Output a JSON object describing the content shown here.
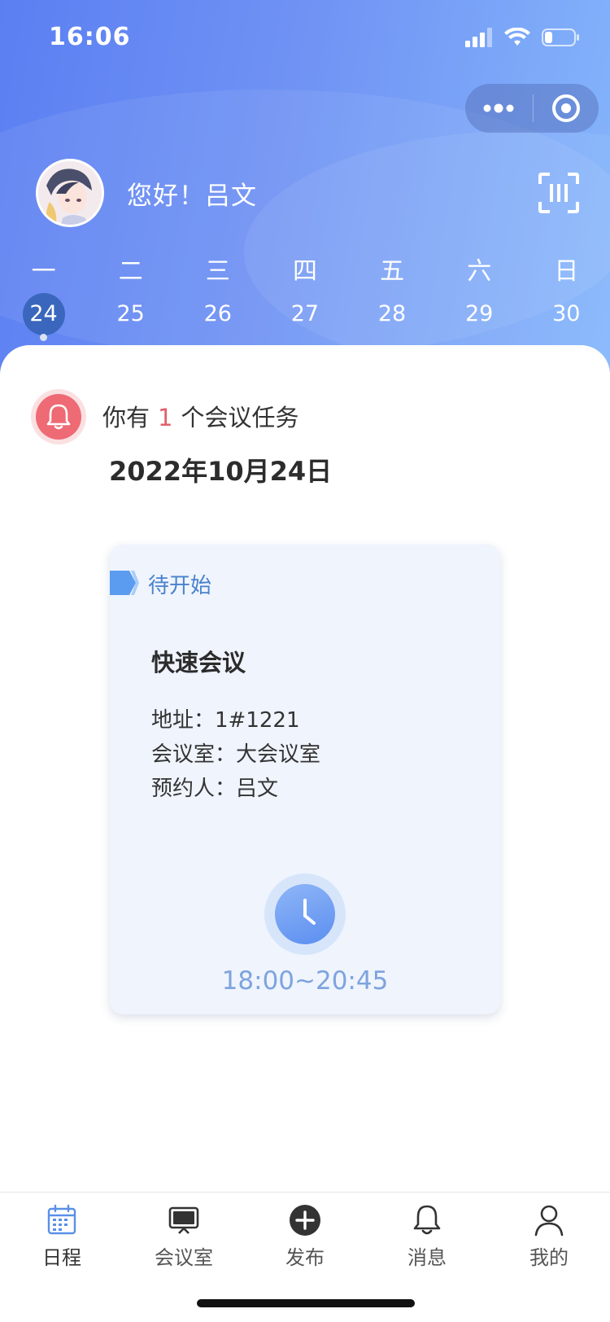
{
  "status_bar": {
    "time": "16:06",
    "icons": [
      "cellular-signal-icon",
      "wifi-icon",
      "battery-icon"
    ]
  },
  "capsule": {
    "icons": [
      "more-icon",
      "close-target-icon"
    ]
  },
  "header": {
    "greeting": "您好！吕文",
    "scan_icon": "scan-icon"
  },
  "calendar": {
    "weekdays": [
      "一",
      "二",
      "三",
      "四",
      "五",
      "六",
      "日"
    ],
    "dates": [
      "24",
      "25",
      "26",
      "27",
      "28",
      "29",
      "30"
    ],
    "selected_date": "24"
  },
  "task_summary": {
    "prefix": "你有",
    "count": "1",
    "suffix": "个会议任务",
    "date_title": "2022年10月24日"
  },
  "meeting": {
    "status": "待开始",
    "title": "快速会议",
    "address": "地址：1#1221",
    "room": "会议室：大会议室",
    "booker": "预约人：吕文",
    "time_range": "18:00~20:45"
  },
  "tabbar": {
    "items": [
      {
        "label": "日程",
        "icon": "calendar-icon",
        "active": true
      },
      {
        "label": "会议室",
        "icon": "monitor-icon",
        "active": false
      },
      {
        "label": "发布",
        "icon": "plus-circle-icon",
        "active": false
      },
      {
        "label": "消息",
        "icon": "bell-icon",
        "active": false
      },
      {
        "label": "我的",
        "icon": "person-icon",
        "active": false
      }
    ]
  },
  "colors": {
    "hero_gradient_start": "#5b7ff2",
    "hero_gradient_end": "#85b6fb",
    "selected_date_bg": "#3a66bd",
    "status_tag_blue": "#4a82cc",
    "task_count_red": "#e2606b",
    "time_range_blue": "#7ea3de",
    "meeting_card_bg": "#eff4fd"
  }
}
